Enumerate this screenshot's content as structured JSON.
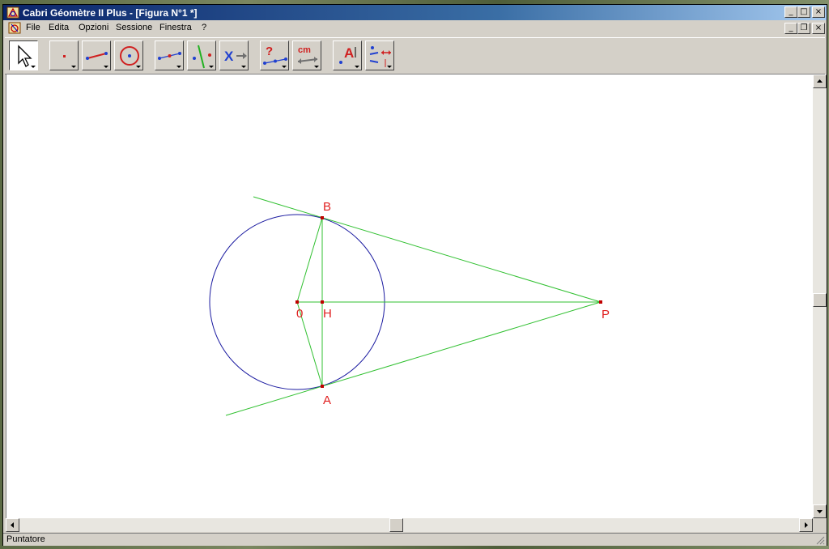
{
  "window": {
    "title": "Cabri Géomètre II Plus - [Figura N°1 *]",
    "caption_buttons": [
      "_",
      "□",
      "×"
    ],
    "doc_buttons": [
      "_",
      "❐",
      "×"
    ]
  },
  "menu": {
    "items": [
      "File",
      "Edita",
      "Opzioni",
      "Sessione",
      "Finestra",
      "?"
    ]
  },
  "toolbar": {
    "tools": [
      {
        "name": "pointer-tool",
        "icon": "arrow-pointer-icon",
        "active": true
      },
      {
        "name": "point-tool",
        "icon": "point-icon"
      },
      {
        "name": "line-tool",
        "icon": "segment-icon"
      },
      {
        "name": "circle-tool",
        "icon": "circle-icon"
      },
      {
        "name": "construct-tool",
        "icon": "midpoint-icon"
      },
      {
        "name": "transform-tool",
        "icon": "perpendicular-icon"
      },
      {
        "name": "macro-tool",
        "icon": "macro-x-icon"
      },
      {
        "name": "check-property-tool",
        "icon": "question-icon"
      },
      {
        "name": "measure-tool",
        "icon": "measure-cm-icon"
      },
      {
        "name": "display-tool",
        "icon": "label-a-icon"
      },
      {
        "name": "draw-tool",
        "icon": "attributes-icon"
      }
    ],
    "measure_label": "cm",
    "check_label": "?",
    "macro_label": "X",
    "label_tool_label": "A"
  },
  "figure": {
    "labels": {
      "B": "B",
      "O": "0",
      "H": "H",
      "P": "P",
      "A": "A"
    },
    "colors": {
      "circle": "#1a1aa0",
      "lines": "#30c030",
      "labels": "#e02020",
      "points": "#c00000"
    }
  },
  "status": {
    "text": "Puntatore"
  }
}
